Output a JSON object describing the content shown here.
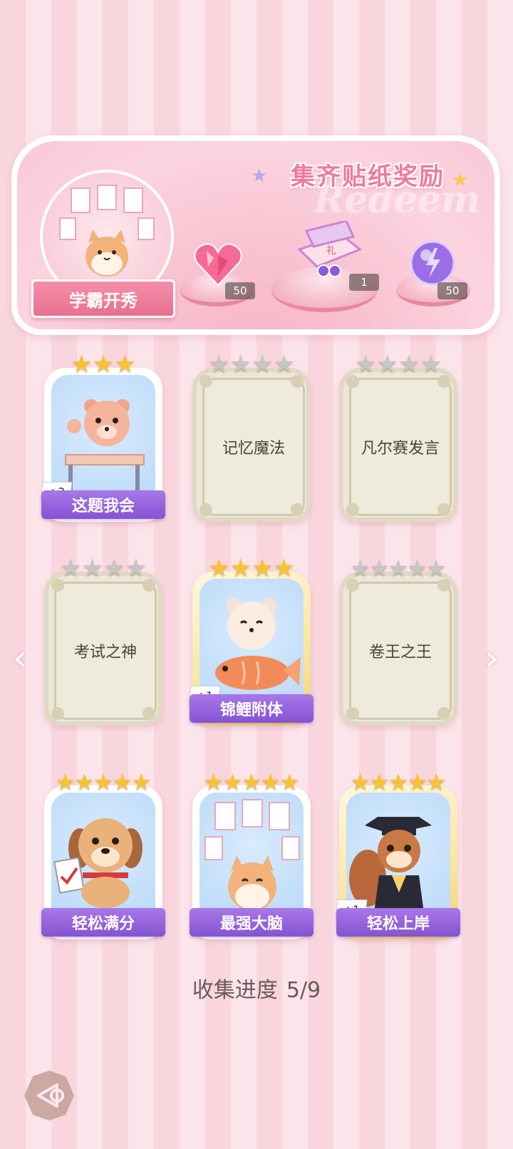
{
  "banner": {
    "title": "集齐贴纸奖励",
    "watermark": "Redeem",
    "sticker_name": "学霸开秀",
    "rewards": [
      {
        "icon": "heart-gem-icon",
        "count": "50"
      },
      {
        "icon": "gift-box-icon",
        "count": "1"
      },
      {
        "icon": "energy-orb-icon",
        "count": "50"
      }
    ]
  },
  "cards": [
    {
      "name": "这题我会",
      "unlocked": true,
      "stars": 3,
      "max_stars": 3,
      "badge": "+3",
      "art": "bear-at-desk-icon"
    },
    {
      "name": "记忆魔法",
      "unlocked": false,
      "stars": 0,
      "max_stars": 4
    },
    {
      "name": "凡尔赛发言",
      "unlocked": false,
      "stars": 0,
      "max_stars": 4
    },
    {
      "name": "考试之神",
      "unlocked": false,
      "stars": 0,
      "max_stars": 4
    },
    {
      "name": "锦鲤附体",
      "unlocked": true,
      "stars": 4,
      "max_stars": 4,
      "badge": "+1",
      "art": "bear-with-koi-icon",
      "gold": true
    },
    {
      "name": "卷王之王",
      "unlocked": false,
      "stars": 0,
      "max_stars": 5
    },
    {
      "name": "轻松满分",
      "unlocked": true,
      "stars": 5,
      "max_stars": 5,
      "art": "puppy-full-marks-icon"
    },
    {
      "name": "最强大脑",
      "unlocked": true,
      "stars": 5,
      "max_stars": 5,
      "art": "cat-with-papers-icon"
    },
    {
      "name": "轻松上岸",
      "unlocked": true,
      "stars": 5,
      "max_stars": 5,
      "badge": "+1",
      "art": "squirrel-graduate-icon",
      "gold": true
    }
  ],
  "progress": {
    "label": "收集进度",
    "value": "5/9"
  },
  "colors": {
    "label_purple": "#8653d1",
    "star_gold": "#f7c332",
    "star_gray": "#c6c6c6",
    "pink_accent": "#f07a9a"
  }
}
